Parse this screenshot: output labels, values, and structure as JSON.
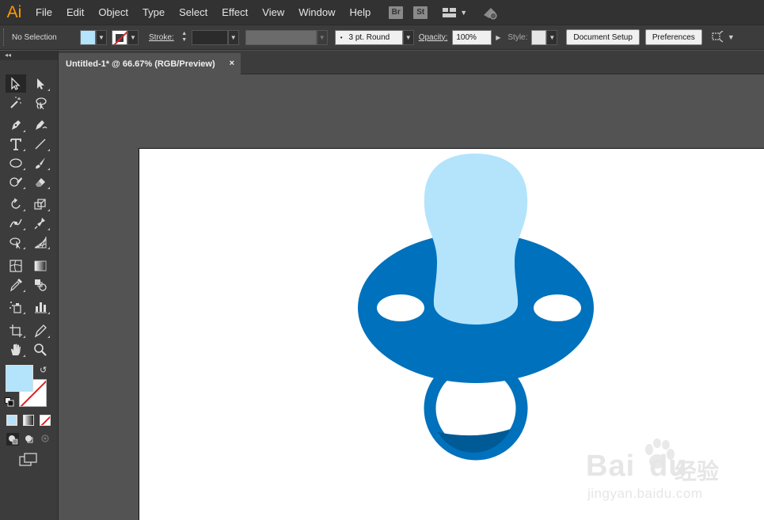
{
  "app": {
    "logo_text": "Ai",
    "accent_color": "#ff9a00"
  },
  "menu": {
    "items": [
      "File",
      "Edit",
      "Object",
      "Type",
      "Select",
      "Effect",
      "View",
      "Window",
      "Help"
    ],
    "bridge_label": "Br",
    "stock_label": "St"
  },
  "control_bar": {
    "selection_label": "No Selection",
    "fill_color": "#b3e4fb",
    "stroke_label": "Stroke:",
    "brush_label": "3 pt. Round",
    "opacity_label": "Opacity:",
    "opacity_value": "100%",
    "style_label": "Style:",
    "document_setup_label": "Document Setup",
    "preferences_label": "Preferences"
  },
  "document": {
    "tab_title": "Untitled-1* @ 66.67% (RGB/Preview)",
    "close_glyph": "×"
  },
  "tools_panel": {
    "collapse_glyph": "◂◂",
    "fill_color": "#b3e4fb",
    "stroke_color": "#ffffff"
  },
  "artwork": {
    "shield_color": "#0071bc",
    "handle_color": "#b3e4fb",
    "ring_color": "#0071bc",
    "ring_shadow_color": "#005a96",
    "holes_color": "#ffffff"
  },
  "watermark": {
    "brand_text": "Bai",
    "brand_text_2": "du",
    "brand_cn": "经验",
    "url": "jingyan.baidu.com"
  }
}
